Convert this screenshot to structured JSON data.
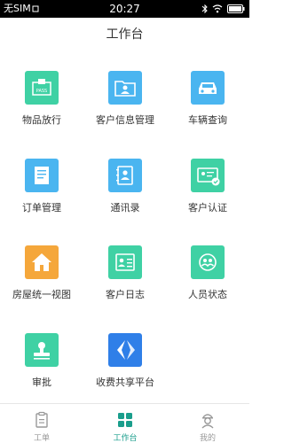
{
  "status_bar": {
    "carrier": "无SIM",
    "time": "20:27"
  },
  "header": {
    "title": "工作台"
  },
  "grid": {
    "items": [
      {
        "label": "物品放行",
        "icon": "package-release-icon",
        "color": "#3fd1a4"
      },
      {
        "label": "客户信息管理",
        "icon": "customer-folder-icon",
        "color": "#4ab5f0"
      },
      {
        "label": "车辆查询",
        "icon": "car-icon",
        "color": "#4ab5f0"
      },
      {
        "label": "订单管理",
        "icon": "document-icon",
        "color": "#4ab5f0"
      },
      {
        "label": "通讯录",
        "icon": "contacts-book-icon",
        "color": "#4ab5f0"
      },
      {
        "label": "客户认证",
        "icon": "id-card-check-icon",
        "color": "#3fd1a4"
      },
      {
        "label": "房屋统一视图",
        "icon": "house-icon",
        "color": "#f5a73b"
      },
      {
        "label": "客户日志",
        "icon": "customer-log-icon",
        "color": "#3fd1a4"
      },
      {
        "label": "人员状态",
        "icon": "people-status-icon",
        "color": "#3fd1a4"
      },
      {
        "label": "审批",
        "icon": "approval-stamp-icon",
        "color": "#3fd1a4"
      },
      {
        "label": "收费共享平台",
        "icon": "payment-share-icon",
        "color": "#2f7fe8"
      }
    ]
  },
  "tabbar": {
    "tabs": [
      {
        "label": "工单",
        "icon": "clipboard-icon"
      },
      {
        "label": "工作台",
        "icon": "grid-icon",
        "active": true
      },
      {
        "label": "我的",
        "icon": "profile-icon"
      }
    ],
    "active_color": "#1a9e8c",
    "inactive_color": "#999999"
  }
}
